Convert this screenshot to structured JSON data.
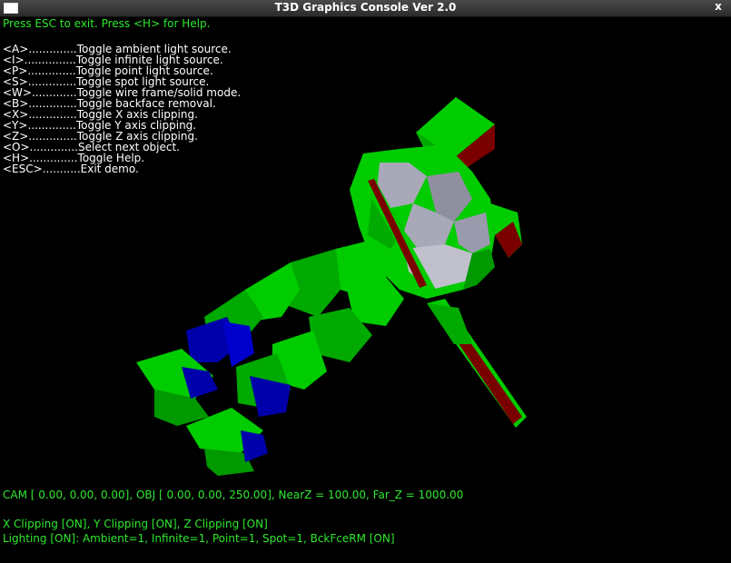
{
  "window": {
    "title": "T3D Graphics Console Ver 2.0",
    "close_glyph": "x"
  },
  "console": {
    "hint": "Press ESC to exit. Press <H> for Help.",
    "help": [
      "<A>..............Toggle ambient light source.",
      "<I>...............Toggle infinite light source.",
      "<P>..............Toggle point light source.",
      "<S>..............Toggle spot light source.",
      "<W>.............Toggle wire frame/solid mode.",
      "<B>..............Toggle backface removal.",
      "<X>..............Toggle X axis clipping.",
      "<Y>..............Toggle Y axis clipping.",
      "<Z>..............Toggle Z axis clipping.",
      "<O>..............Select next object.",
      "<H>..............Toggle Help.",
      "<ESC>...........Exit demo."
    ],
    "cam_line": "CAM [ 0.00,  0.00,  0.00], OBJ [ 0.00,  0.00, 250.00], NearZ = 100.00, Far_Z = 1000.00",
    "clip_line": "X Clipping [ON], Y Clipping [ON], Z Clipping [ON]",
    "light_line": "Lighting [ON]: Ambient=1, Infinite=1, Point=1, Spot=1, BckFceRM [ON]"
  },
  "colors": {
    "text_green": "#2ee82e",
    "text_white": "#ffffff",
    "mech_green": "#00cc00",
    "mech_dark_green": "#007a00",
    "mech_gray": "#a8a8b8",
    "mech_red": "#7a0000",
    "mech_blue": "#0000aa"
  }
}
